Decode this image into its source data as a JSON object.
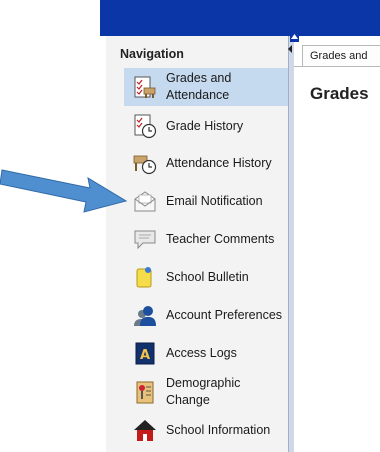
{
  "navigation": {
    "title": "Navigation",
    "items": [
      {
        "label_line1": "Grades and",
        "label_line2": "Attendance",
        "icon": "grades-attendance-icon",
        "selected": true
      },
      {
        "label_line1": "Grade History",
        "label_line2": "",
        "icon": "grade-history-icon",
        "selected": false
      },
      {
        "label_line1": "Attendance History",
        "label_line2": "",
        "icon": "attendance-history-icon",
        "selected": false
      },
      {
        "label_line1": "Email Notification",
        "label_line2": "",
        "icon": "email-notification-icon",
        "selected": false
      },
      {
        "label_line1": "Teacher Comments",
        "label_line2": "",
        "icon": "teacher-comments-icon",
        "selected": false
      },
      {
        "label_line1": "School Bulletin",
        "label_line2": "",
        "icon": "school-bulletin-icon",
        "selected": false
      },
      {
        "label_line1": "Account Preferences",
        "label_line2": "",
        "icon": "account-preferences-icon",
        "selected": false
      },
      {
        "label_line1": "Access Logs",
        "label_line2": "",
        "icon": "access-logs-icon",
        "selected": false
      },
      {
        "label_line1": "Demographic",
        "label_line2": "Change",
        "icon": "demographic-change-icon",
        "selected": false
      },
      {
        "label_line1": "School Information",
        "label_line2": "",
        "icon": "school-information-icon",
        "selected": false
      }
    ]
  },
  "main": {
    "tab_label": "Grades and",
    "page_title": "Grades"
  },
  "colors": {
    "header": "#0a36a8",
    "selected": "#c5d9ef",
    "annotation_arrow": "#4f8fd0"
  }
}
